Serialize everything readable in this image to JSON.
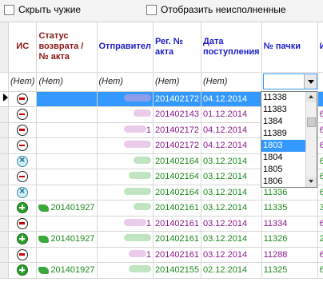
{
  "filters": {
    "hide_foreign": "Скрыть чужие",
    "show_unfulfilled": "Отобразить неисполненные"
  },
  "columns": {
    "is": "ИС",
    "status": "Статус возврата / № акта",
    "sender": "Отправител",
    "reg": "Рег. № акта",
    "date": "Дата поступления",
    "pack": "№ пачки",
    "extra": "И"
  },
  "filter_row": {
    "is": "(Нет)",
    "status": "(Нет)",
    "sender": "(Нет)",
    "reg": "(Нет)",
    "date": "(Нет)"
  },
  "rows": [
    {
      "icon": "minus",
      "status": "",
      "sender": "",
      "reg": "201402172",
      "date": "04.12.2014",
      "pack": "",
      "extra": "",
      "color": "purple",
      "selected": true
    },
    {
      "icon": "minus",
      "status": "",
      "sender": "",
      "reg": "201402143",
      "date": "01.12.2014",
      "pack": "",
      "extra": "6",
      "color": "purple"
    },
    {
      "icon": "minus",
      "status": "",
      "sender": "1",
      "reg": "201402172",
      "date": "04.12.2014",
      "pack": "",
      "extra": "6",
      "color": "purple"
    },
    {
      "icon": "minus",
      "status": "",
      "sender": "",
      "reg": "201402172",
      "date": "04.12.2014",
      "pack": "",
      "extra": "6",
      "color": "purple"
    },
    {
      "icon": "cross",
      "status": "",
      "sender": "",
      "reg": "201402164",
      "date": "03.12.2014",
      "pack": "",
      "extra": "6",
      "color": "green"
    },
    {
      "icon": "minus",
      "status": "",
      "sender": "",
      "reg": "201402164",
      "date": "03.12.2014",
      "pack": "",
      "extra": "6",
      "color": "green"
    },
    {
      "icon": "cross",
      "status": "",
      "sender": "",
      "reg": "201402164",
      "date": "03.12.2014",
      "pack": "11336",
      "extra": "6",
      "color": "green"
    },
    {
      "icon": "plus",
      "status": "201401927",
      "sender": "",
      "reg": "201402161",
      "date": "03.12.2014",
      "pack": "11335",
      "extra": "3",
      "color": "green"
    },
    {
      "icon": "minus",
      "status": "",
      "sender": "1",
      "reg": "201402161",
      "date": "03.12.2014",
      "pack": "11334",
      "extra": "6",
      "color": "purple"
    },
    {
      "icon": "plus",
      "status": "201401927",
      "sender": "",
      "reg": "201402161",
      "date": "03.12.2014",
      "pack": "11326",
      "extra": "2",
      "color": "green"
    },
    {
      "icon": "minus",
      "status": "",
      "sender": "1",
      "reg": "201402161",
      "date": "03.12.2014",
      "pack": "11288",
      "extra": "6",
      "color": "purple"
    },
    {
      "icon": "plus",
      "status": "201401927",
      "sender": "",
      "reg": "201402155",
      "date": "02.12.2014",
      "pack": "11325",
      "extra": "6",
      "color": "green"
    }
  ],
  "dropdown": {
    "options": [
      "11338",
      "11383",
      "1384",
      "11389",
      "1803",
      "1804",
      "1805",
      "1806"
    ],
    "active": "1803"
  },
  "colors": {
    "selection": "#3399ff",
    "purple": "#8b1a8b",
    "green": "#1e8a1e",
    "header_blue": "#1c1cc8",
    "header_red": "#8b1414"
  }
}
